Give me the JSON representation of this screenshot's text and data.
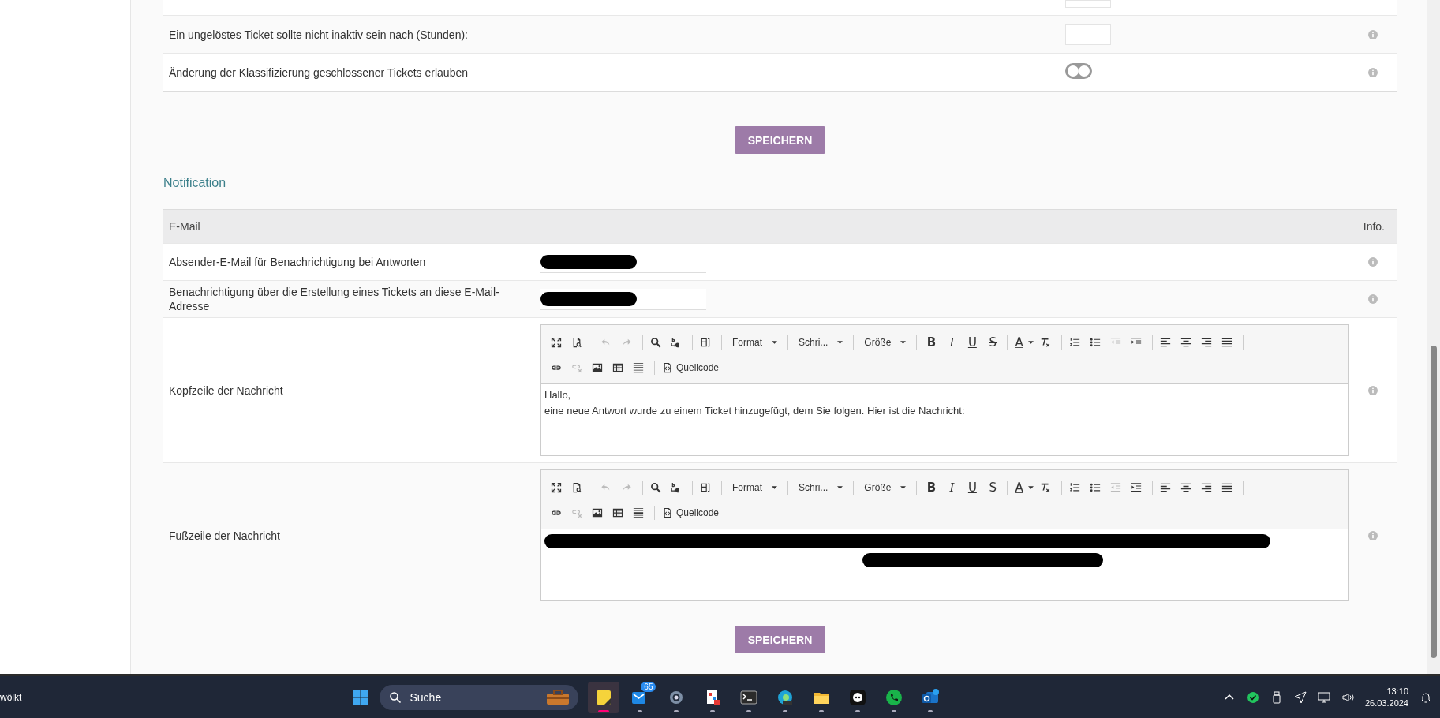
{
  "settings_table": {
    "rows": [
      {
        "label": "Ein ungelöstes Ticket sollte nicht inaktiv sein nach (Stunden):",
        "kind": "number"
      },
      {
        "label": "Änderung der Klassifizierung geschlossener Tickets erlauben",
        "kind": "toggle",
        "on": false
      }
    ]
  },
  "save_button": "SPEICHERN",
  "section_title": "Notification",
  "email_table": {
    "columns": [
      "E-Mail",
      "Info."
    ],
    "rows": [
      {
        "label": "Absender-E-Mail für Benachrichtigung bei Antworten",
        "kind": "email",
        "redacted": true
      },
      {
        "label": "Benachrichtigung über die Erstellung eines Tickets an diese E-Mail-Adresse",
        "kind": "email",
        "redacted": true
      },
      {
        "label": "Kopfzeile der Nachricht",
        "kind": "editor",
        "toolbar": [
          {
            "kind": "maximize",
            "disabled": false
          },
          {
            "kind": "preview",
            "disabled": false
          },
          {
            "kind": "sep"
          },
          {
            "kind": "undo",
            "disabled": true
          },
          {
            "kind": "redo",
            "disabled": true
          },
          {
            "kind": "sep"
          },
          {
            "kind": "find",
            "disabled": false
          },
          {
            "kind": "replace",
            "disabled": false
          },
          {
            "kind": "sep"
          },
          {
            "kind": "template",
            "disabled": false
          },
          {
            "kind": "sep"
          },
          {
            "kind": "dropdown",
            "label": "Format"
          },
          {
            "kind": "sep"
          },
          {
            "kind": "dropdown",
            "label": "Schri..."
          },
          {
            "kind": "sep"
          },
          {
            "kind": "dropdown",
            "label": "Größe"
          },
          {
            "kind": "sep"
          },
          {
            "kind": "bold",
            "label": "B"
          },
          {
            "kind": "italic",
            "label": "I"
          },
          {
            "kind": "underline",
            "label": "U"
          },
          {
            "kind": "strike",
            "label": "S"
          },
          {
            "kind": "sep"
          },
          {
            "kind": "textcolor",
            "label": "A"
          },
          {
            "kind": "clearformat",
            "disabled": false
          },
          {
            "kind": "sep"
          },
          {
            "kind": "ol",
            "disabled": false
          },
          {
            "kind": "ul",
            "disabled": false
          },
          {
            "kind": "outdent",
            "disabled": true
          },
          {
            "kind": "indent",
            "disabled": false
          },
          {
            "kind": "sep"
          },
          {
            "kind": "alignleft",
            "disabled": false
          },
          {
            "kind": "aligncenter",
            "disabled": false
          },
          {
            "kind": "alignright",
            "disabled": false
          },
          {
            "kind": "justify",
            "disabled": false
          },
          {
            "kind": "sep"
          },
          {
            "kind": "break"
          },
          {
            "kind": "link",
            "disabled": false
          },
          {
            "kind": "unlink",
            "disabled": true
          },
          {
            "kind": "image",
            "disabled": false
          },
          {
            "kind": "table",
            "disabled": false
          },
          {
            "kind": "hr",
            "disabled": false
          },
          {
            "kind": "sep"
          },
          {
            "kind": "source",
            "label": "Quellcode"
          }
        ],
        "lines": [
          {
            "kind": "text",
            "text": "Hallo,"
          },
          {
            "kind": "text",
            "text": "eine neue Antwort wurde zu einem Ticket hinzugefügt, dem Sie folgen. Hier ist die Nachricht:"
          }
        ]
      },
      {
        "label": "Fußzeile der Nachricht",
        "kind": "editor",
        "toolbar": [
          {
            "kind": "maximize",
            "disabled": false
          },
          {
            "kind": "preview",
            "disabled": false
          },
          {
            "kind": "sep"
          },
          {
            "kind": "undo",
            "disabled": true
          },
          {
            "kind": "redo",
            "disabled": true
          },
          {
            "kind": "sep"
          },
          {
            "kind": "find",
            "disabled": false
          },
          {
            "kind": "replace",
            "disabled": false
          },
          {
            "kind": "sep"
          },
          {
            "kind": "template",
            "disabled": false
          },
          {
            "kind": "sep"
          },
          {
            "kind": "dropdown",
            "label": "Format"
          },
          {
            "kind": "sep"
          },
          {
            "kind": "dropdown",
            "label": "Schri..."
          },
          {
            "kind": "sep"
          },
          {
            "kind": "dropdown",
            "label": "Größe"
          },
          {
            "kind": "sep"
          },
          {
            "kind": "bold",
            "label": "B"
          },
          {
            "kind": "italic",
            "label": "I"
          },
          {
            "kind": "underline",
            "label": "U"
          },
          {
            "kind": "strike",
            "label": "S"
          },
          {
            "kind": "sep"
          },
          {
            "kind": "textcolor",
            "label": "A"
          },
          {
            "kind": "clearformat",
            "disabled": false
          },
          {
            "kind": "sep"
          },
          {
            "kind": "ol",
            "disabled": false
          },
          {
            "kind": "ul",
            "disabled": false
          },
          {
            "kind": "outdent",
            "disabled": true
          },
          {
            "kind": "indent",
            "disabled": false
          },
          {
            "kind": "sep"
          },
          {
            "kind": "alignleft",
            "disabled": false
          },
          {
            "kind": "aligncenter",
            "disabled": false
          },
          {
            "kind": "alignright",
            "disabled": false
          },
          {
            "kind": "justify",
            "disabled": false
          },
          {
            "kind": "sep"
          },
          {
            "kind": "break"
          },
          {
            "kind": "link",
            "disabled": false
          },
          {
            "kind": "unlink",
            "disabled": true
          },
          {
            "kind": "image",
            "disabled": false
          },
          {
            "kind": "table",
            "disabled": false
          },
          {
            "kind": "hr",
            "disabled": false
          },
          {
            "kind": "sep"
          },
          {
            "kind": "source",
            "label": "Quellcode"
          }
        ],
        "lines": [
          {
            "kind": "redacted_wide"
          },
          {
            "kind": "redacted_centered"
          }
        ]
      }
    ]
  },
  "save_button_bottom": "SPEICHERN",
  "taskbar": {
    "weather_text": "wölkt",
    "search_placeholder": "Suche",
    "apps": [
      {
        "kind": "notes",
        "selected": true
      },
      {
        "kind": "mail",
        "selected": false,
        "badge": "65"
      },
      {
        "kind": "gear",
        "selected": false
      },
      {
        "kind": "doc",
        "selected": false
      },
      {
        "kind": "terminal",
        "selected": false
      },
      {
        "kind": "browser",
        "selected": false
      },
      {
        "kind": "folder",
        "selected": false
      },
      {
        "kind": "chat",
        "selected": false
      },
      {
        "kind": "phone",
        "selected": false
      },
      {
        "kind": "outlook",
        "selected": false
      }
    ],
    "time": "13:10",
    "date": "26.03.2024"
  }
}
